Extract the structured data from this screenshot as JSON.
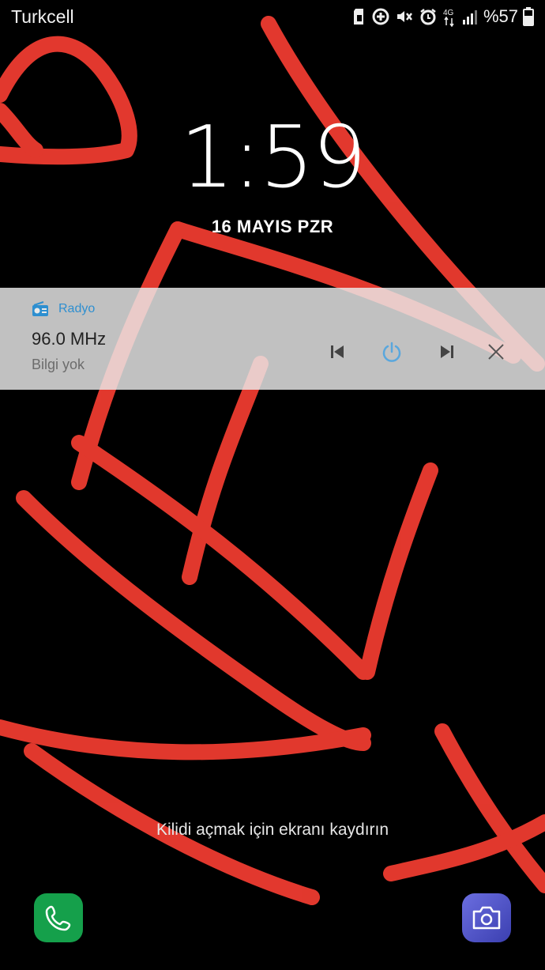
{
  "status_bar": {
    "carrier": "Turkcell",
    "network": "4G",
    "battery": "%57"
  },
  "lockscreen": {
    "time": "1:59",
    "date": "16 MAYIS PZR",
    "unlock_hint": "Kilidi açmak için ekranı kaydırın"
  },
  "notification": {
    "app_name": "Radyo",
    "title": "96.0 MHz",
    "subtitle": "Bilgi yok",
    "accent_color": "#2e8fd0",
    "controls": [
      "skip-previous-icon",
      "power-icon",
      "skip-next-icon",
      "close-icon"
    ]
  },
  "shortcuts": {
    "left": "phone-icon",
    "right": "camera-icon"
  }
}
